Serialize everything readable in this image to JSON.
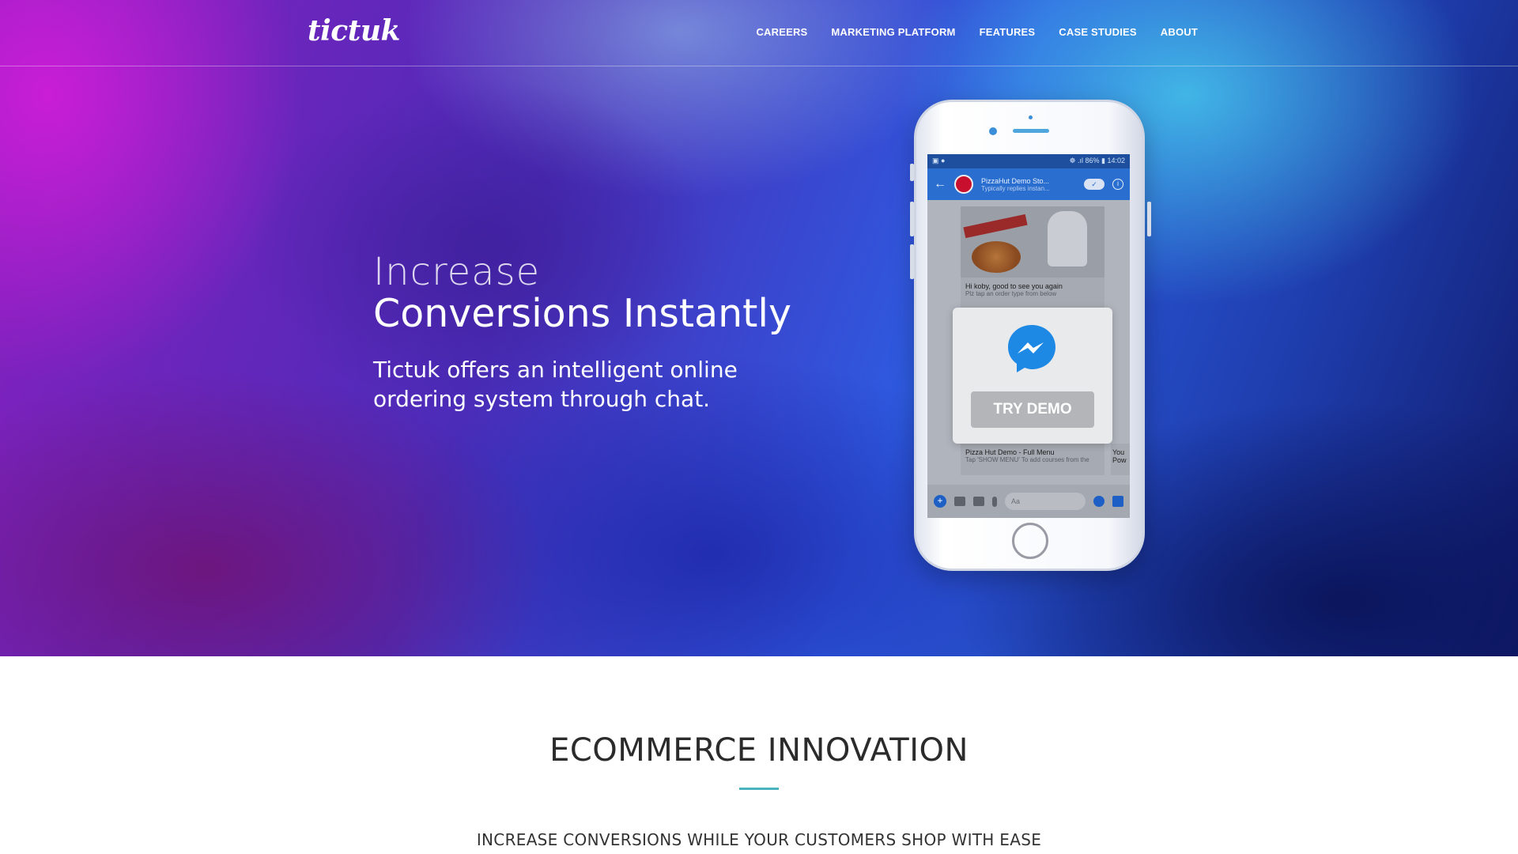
{
  "nav": {
    "logo": "tictuk",
    "links": [
      "CAREERS",
      "MARKETING PLATFORM",
      "FEATURES",
      "CASE STUDIES",
      "ABOUT"
    ]
  },
  "hero": {
    "headline_light": "Increase",
    "headline_bold": "Conversions Instantly",
    "subline": "Tictuk offers an intelligent online ordering system through chat."
  },
  "phone": {
    "status_bar": {
      "left": "▣ ●",
      "right": "☸ .ıl 86% ▮ 14:02"
    },
    "chat": {
      "name": "PizzaHut Demo Sto...",
      "subtitle": "Typically replies instan...",
      "greeting": "Hi koby, good to see you again",
      "greeting_sub": "Plz tap an order type from below",
      "menu_title": "Pizza Hut Demo - Full Menu",
      "menu_sub": "Tap 'SHOW MENU' To add courses from the",
      "menu_peek": "You Pow",
      "input_placeholder": "Aa"
    },
    "demo_button": "TRY DEMO"
  },
  "section": {
    "title": "ECOMMERCE INNOVATION",
    "subtitle": "INCREASE CONVERSIONS WHILE YOUR CUSTOMERS SHOP WITH EASE"
  },
  "colors": {
    "accent": "#4ab3bd",
    "messenger_blue": "#1e88e5",
    "button_gray": "#b3b5b9"
  }
}
